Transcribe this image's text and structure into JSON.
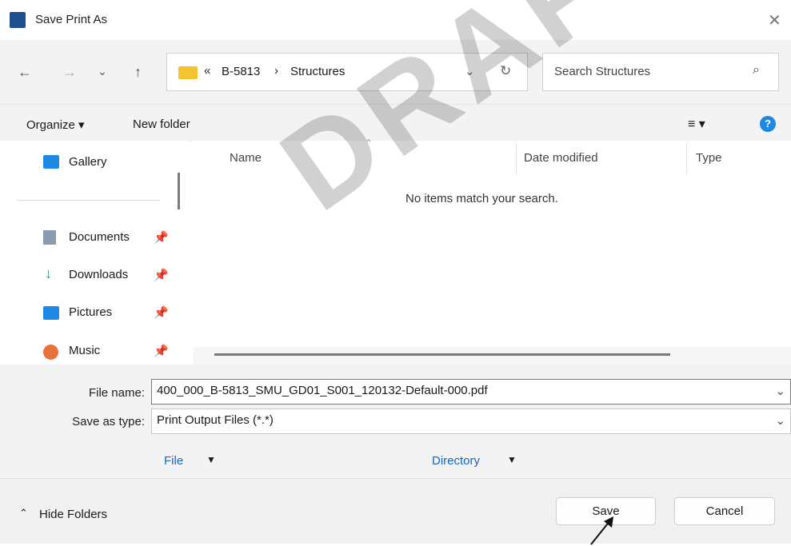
{
  "window": {
    "title": "Save Print As"
  },
  "address": {
    "overflow": "«",
    "crumbs": [
      "B-5813",
      "Structures"
    ]
  },
  "search": {
    "placeholder": "Search Structures"
  },
  "toolbar": {
    "organize": "Organize ▾",
    "new_folder": "New folder"
  },
  "sidebar": {
    "gallery": "Gallery",
    "items": [
      {
        "label": "Documents",
        "icon": "document-icon"
      },
      {
        "label": "Downloads",
        "icon": "download-icon"
      },
      {
        "label": "Pictures",
        "icon": "pictures-icon"
      },
      {
        "label": "Music",
        "icon": "music-icon"
      }
    ]
  },
  "files": {
    "columns": [
      "Name",
      "Date modified",
      "Type"
    ],
    "empty_message": "No items match your search."
  },
  "form": {
    "file_name_label": "File name:",
    "file_name_value": "400_000_B-5813_SMU_GD01_S001_120132-Default-000.pdf",
    "type_label": "Save as type:",
    "type_value": "Print Output Files (*.*)",
    "file_link": "File",
    "directory_link": "Directory"
  },
  "footer": {
    "hide_folders": "Hide Folders",
    "save": "Save",
    "cancel": "Cancel"
  },
  "watermark": "DRAFT",
  "colors": {
    "accent": "#1565c0",
    "folder": "#f4c430",
    "help": "#1e88e5"
  }
}
